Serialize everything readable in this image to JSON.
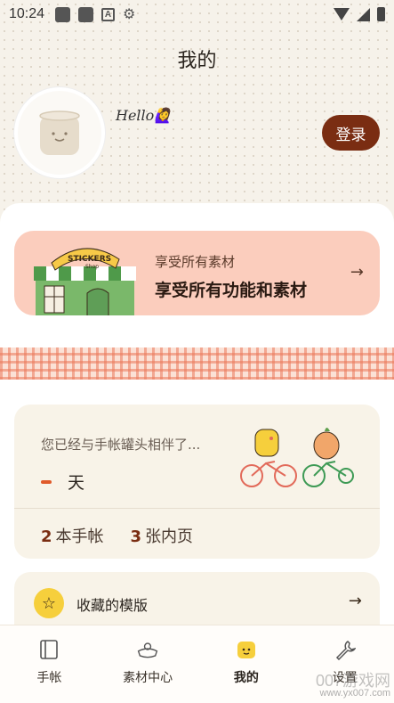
{
  "status_bar": {
    "time": "10:24"
  },
  "header": {
    "title": "我的"
  },
  "profile": {
    "greeting": "Hello🙋‍♀️",
    "login_label": "登录"
  },
  "promo": {
    "subtitle": "享受所有素材",
    "title": "享受所有功能和素材",
    "arrow": "→",
    "shop_sign": "STICKERS",
    "shop_sub": "Shop"
  },
  "stats": {
    "companion_text": "您已经与手帐罐头相伴了...",
    "days_unit": "天",
    "journals_count": "2",
    "journals_label": "本手帐",
    "pages_count": "3",
    "pages_label": "张内页"
  },
  "favorites": {
    "label": "收藏的模版",
    "arrow": "→"
  },
  "tabs": [
    {
      "label": "手帐",
      "icon": "notebook-icon"
    },
    {
      "label": "素材中心",
      "icon": "materials-icon"
    },
    {
      "label": "我的",
      "icon": "my-face-icon",
      "active": true
    },
    {
      "label": "设置",
      "icon": "wrench-icon"
    }
  ],
  "watermark": {
    "line1": "007游戏网",
    "line2": "www.yx007.com"
  },
  "colors": {
    "accent": "#7a2d12",
    "promo_bg": "#fbcdbd",
    "card_bg": "#f8f3e8",
    "star": "#f6cf3c"
  }
}
